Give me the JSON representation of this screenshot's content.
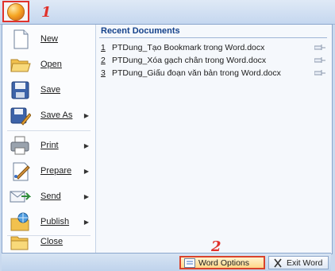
{
  "app": {
    "step1": "1",
    "step2": "2"
  },
  "menu": {
    "items": [
      {
        "label": "New",
        "icon": "new-document-icon",
        "submenu": false
      },
      {
        "label": "Open",
        "icon": "open-folder-icon",
        "submenu": false
      },
      {
        "label": "Save",
        "icon": "save-disk-icon",
        "submenu": false
      },
      {
        "label": "Save As",
        "icon": "save-as-icon",
        "submenu": true
      },
      {
        "label": "Print",
        "icon": "printer-icon",
        "submenu": true
      },
      {
        "label": "Prepare",
        "icon": "prepare-icon",
        "submenu": true
      },
      {
        "label": "Send",
        "icon": "send-icon",
        "submenu": true
      },
      {
        "label": "Publish",
        "icon": "publish-icon",
        "submenu": true
      },
      {
        "label": "Close",
        "icon": "close-folder-icon",
        "submenu": false
      }
    ]
  },
  "recent": {
    "title": "Recent Documents",
    "docs": [
      {
        "num": "1",
        "name": "PTDung_Tạo Bookmark trong Word.docx"
      },
      {
        "num": "2",
        "name": "PTDung_Xóa gạch chân trong Word.docx"
      },
      {
        "num": "3",
        "name": "PTDung_Giấu đoạn văn bản trong Word.docx"
      }
    ]
  },
  "footer": {
    "word_options": "Word Options",
    "exit_word": "Exit Word"
  }
}
